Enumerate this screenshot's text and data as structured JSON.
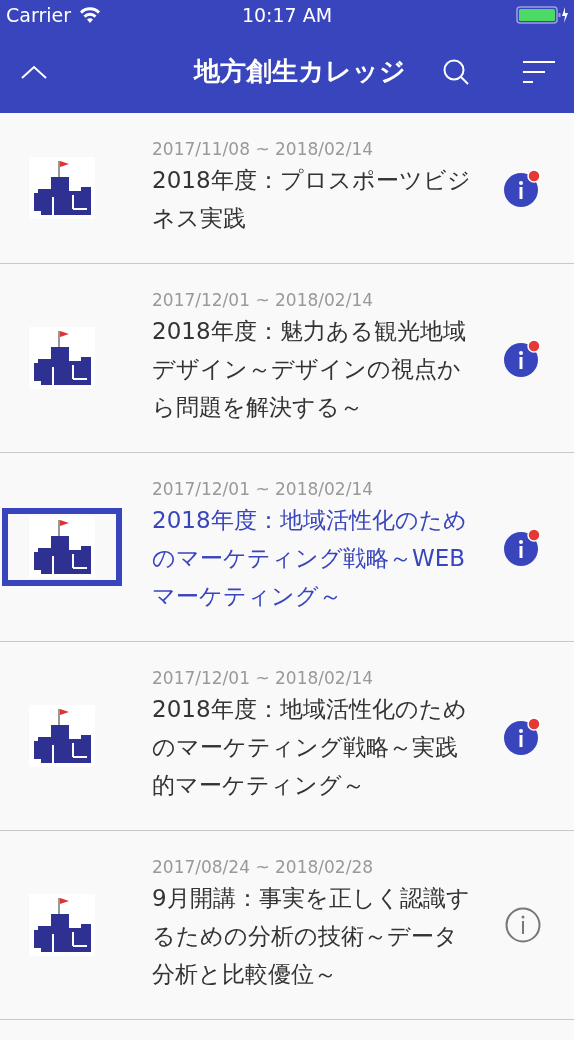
{
  "status_bar": {
    "carrier": "Carrier",
    "time": "10:17 AM"
  },
  "nav": {
    "title": "地方創生カレッジ"
  },
  "courses": [
    {
      "period": "2017/11/08 ~ 2018/02/14",
      "title": "2018年度：プロスポーツビジネス実践",
      "selected": false,
      "unread": true
    },
    {
      "period": "2017/12/01 ~ 2018/02/14",
      "title": "2018年度：魅力ある観光地域デザイン～デザインの視点から問題を解決する～",
      "selected": false,
      "unread": true
    },
    {
      "period": "2017/12/01 ~ 2018/02/14",
      "title": "2018年度：地域活性化のためのマーケティング戦略～WEBマーケティング～",
      "selected": true,
      "unread": true
    },
    {
      "period": "2017/12/01 ~ 2018/02/14",
      "title": "2018年度：地域活性化のためのマーケティング戦略～実践的マーケティング～",
      "selected": false,
      "unread": true
    },
    {
      "period": "2017/08/24 ~ 2018/02/28",
      "title": "9月開講：事実を正しく認識するための分析の技術～データ分析と比較優位～",
      "selected": false,
      "unread": false
    }
  ]
}
